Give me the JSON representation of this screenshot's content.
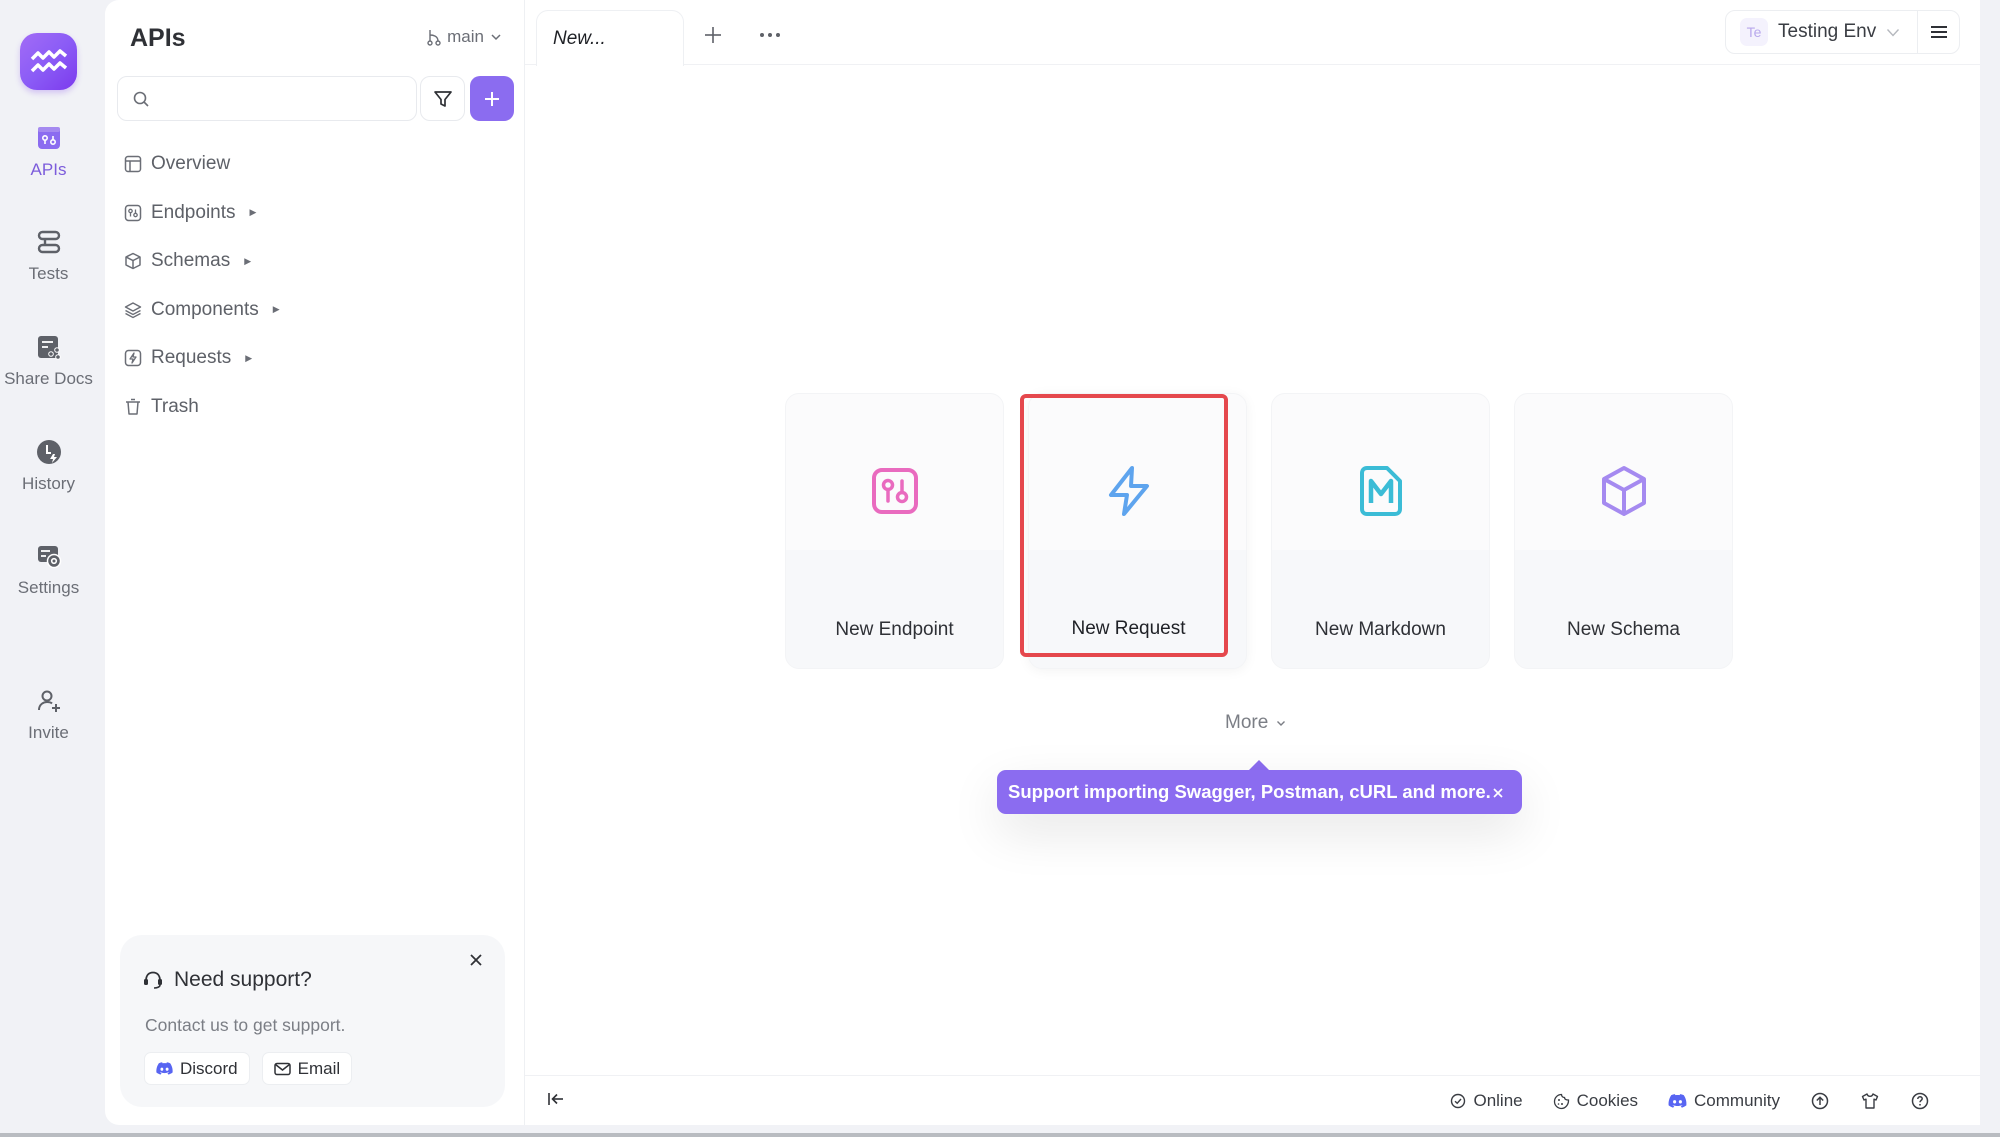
{
  "rail": {
    "logo_icon": "brand-wave-logo",
    "items": [
      {
        "label": "APIs",
        "icon": "api-box-icon",
        "active": true
      },
      {
        "label": "Tests",
        "icon": "tests-stack-icon",
        "active": false
      },
      {
        "label": "Share Docs",
        "icon": "share-docs-icon",
        "active": false
      },
      {
        "label": "History",
        "icon": "history-clock-icon",
        "active": false
      },
      {
        "label": "Settings",
        "icon": "settings-icon",
        "active": false
      },
      {
        "label": "Invite",
        "icon": "invite-user-icon",
        "active": false
      }
    ]
  },
  "sidebar": {
    "title": "APIs",
    "branch": "main",
    "search": {
      "value": "",
      "placeholder": ""
    },
    "tree": [
      {
        "label": "Overview",
        "icon": "layout-icon",
        "has_children": false
      },
      {
        "label": "Endpoints",
        "icon": "endpoint-icon",
        "has_children": true
      },
      {
        "label": "Schemas",
        "icon": "cube-icon",
        "has_children": true
      },
      {
        "label": "Components",
        "icon": "layers-icon",
        "has_children": true
      },
      {
        "label": "Requests",
        "icon": "bolt-box-icon",
        "has_children": true
      },
      {
        "label": "Trash",
        "icon": "trash-icon",
        "has_children": false
      }
    ],
    "support": {
      "title": "Need support?",
      "description": "Contact us to get support.",
      "buttons": [
        "Discord",
        "Email"
      ]
    }
  },
  "tabs": [
    {
      "label": "New...",
      "active": true
    }
  ],
  "environment": {
    "badge": "Te",
    "name": "Testing Env"
  },
  "cards": [
    {
      "label": "New Endpoint",
      "icon": "endpoint-icon",
      "color": "#e96bbf"
    },
    {
      "label": "New Request",
      "icon": "bolt-icon",
      "color": "#5ea4ee",
      "highlighted": true
    },
    {
      "label": "New Markdown",
      "icon": "markdown-icon",
      "color": "#3bbcd6"
    },
    {
      "label": "New Schema",
      "icon": "cube-icon",
      "color": "#a58af0"
    }
  ],
  "more_label": "More",
  "tooltip": {
    "text": "Support importing Swagger, Postman, cURL and more."
  },
  "statusbar": {
    "items": [
      "Online",
      "Cookies",
      "Community"
    ]
  },
  "colors": {
    "accent": "#8b6cf0",
    "highlight": "#e5484d",
    "discord": "#5865f2"
  }
}
